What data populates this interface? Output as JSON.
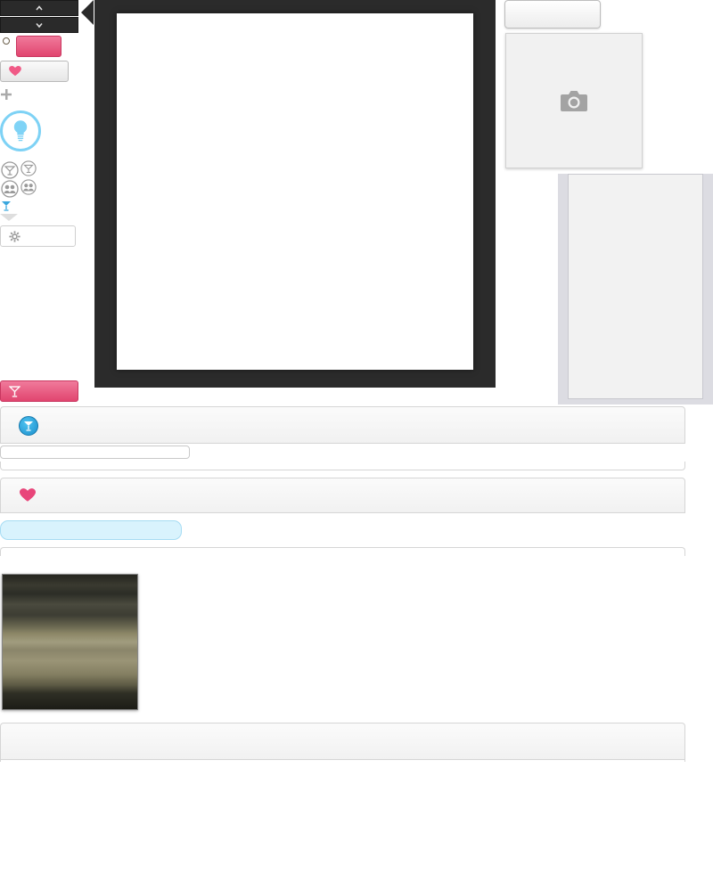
{
  "spinner": {
    "up_icon": "chevron-up-icon",
    "down_icon": "chevron-down-icon"
  },
  "left_toolbar": {
    "heart_icon": "heart-icon",
    "plus_icon": "plus-icon",
    "bulb_icon": "lightbulb-icon",
    "cocktail_icon": "cocktail-icon",
    "people_icon": "people-icon",
    "gear_icon": "gear-icon"
  },
  "right_panel": {
    "camera_icon": "camera-icon"
  },
  "sections": [
    {
      "icon": "cocktail-icon",
      "progress": 0
    },
    {
      "icon": "heart-icon",
      "progress": 1
    }
  ],
  "colors": {
    "accent_pink": "#e1456f",
    "accent_blue": "#1b8fcd",
    "dark_frame": "#2b2b2b"
  }
}
